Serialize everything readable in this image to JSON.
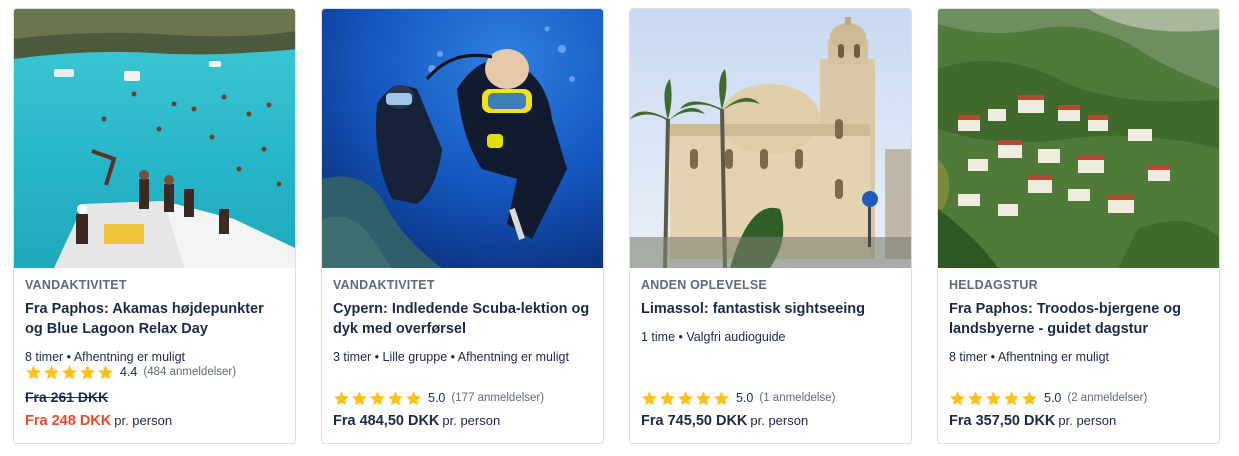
{
  "colors": {
    "text": "#1a2b49",
    "muted": "#63687a",
    "discount": "#eb4a27",
    "star": "#ffc21c",
    "border": "#dcdfe4"
  },
  "cards": [
    {
      "category": "VANDAKTIVITET",
      "title": "Fra Paphos: Akamas højdepunkter og Blue Lagoon Relax Day",
      "meta": "8 timer • Afhentning er muligt",
      "rating": "4.4",
      "star_count": 5,
      "reviews": "(484 anmeldelser)",
      "old_price": "Fra 261 DKK",
      "price": "Fra 248 DKK",
      "per": "pr. person",
      "image": "lagoon-boat-photo"
    },
    {
      "category": "VANDAKTIVITET",
      "title": "Cypern: Indledende Scuba-lektion og dyk med overførsel",
      "meta": "3 timer • Lille gruppe • Afhentning er muligt",
      "rating": "5.0",
      "star_count": 5,
      "reviews": "(177 anmeldelser)",
      "price": "Fra 484,50 DKK",
      "per": "pr. person",
      "image": "scuba-divers-photo"
    },
    {
      "category": "ANDEN OPLEVELSE",
      "title": "Limassol: fantastisk sightseeing",
      "meta": "1 time • Valgfri audioguide",
      "rating": "5.0",
      "star_count": 5,
      "reviews": "(1 anmeldelse)",
      "price": "Fra 745,50 DKK",
      "per": "pr. person",
      "image": "cathedral-palms-photo"
    },
    {
      "category": "HELDAGSTUR",
      "title": "Fra Paphos: Troodos-bjergene og landsbyerne - guidet dagstur",
      "meta": "8 timer • Afhentning er muligt",
      "rating": "5.0",
      "star_count": 5,
      "reviews": "(2 anmeldelser)",
      "price": "Fra 357,50 DKK",
      "per": "pr. person",
      "image": "mountain-village-photo"
    }
  ]
}
